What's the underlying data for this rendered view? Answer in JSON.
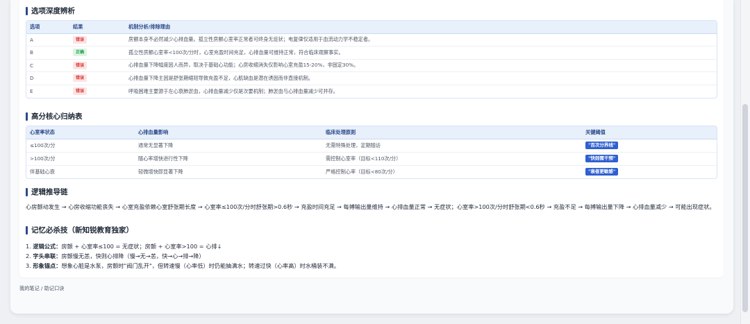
{
  "sections": {
    "analysis_title": "选项深度辨析",
    "summary_title": "高分核心归纳表",
    "logic_title": "逻辑推导链",
    "memory_title": "记忆必杀技（新知锐教育独家）"
  },
  "analysis_table": {
    "headers": [
      "选项",
      "结果",
      "机制分析/排除理由"
    ],
    "rows": [
      {
        "option": "A",
        "result": "错误",
        "result_type": "wrong",
        "reason": "房颤本身不必然减少心排血量。孤立性房颤心室率正常者可终身无症状；电复律仅适用于血流动力学不稳定者。"
      },
      {
        "option": "B",
        "result": "正确",
        "result_type": "right",
        "reason": "孤立性房颤心室率<100次/分时，心室充盈时间充足，心排血量可维持正常，符合临床观察事实。"
      },
      {
        "option": "C",
        "result": "错误",
        "result_type": "wrong",
        "reason": "心排血量下降幅度因人而异，取决于基础心功能；心房收缩消失仅影响心室充盈15-20%，非固定30%。"
      },
      {
        "option": "D",
        "result": "错误",
        "result_type": "wrong",
        "reason": "心排血量下降主因是舒张期缩短导致充盈不足，心肌缺血是潜在诱因而非直接机制。"
      },
      {
        "option": "E",
        "result": "错误",
        "result_type": "wrong",
        "reason": "呼吸困难主要源于左心衰肺淤血，心排血量减少仅是次要机制；肺淤血与心排血量减少可并存。"
      }
    ]
  },
  "summary_table": {
    "headers": [
      "心室率状态",
      "心排血量影响",
      "临床处理原则",
      "关键阈值"
    ],
    "rows": [
      {
        "state": "≤100次/分",
        "effect": "通常无显著下降",
        "principle": "无需特殊处理，定期随访",
        "threshold": "\"百次分界线\""
      },
      {
        "state": ">100次/分",
        "effect": "随心率增快进行性下降",
        "principle": "需控制心室率（目标<110次/分）",
        "threshold": "\"快则需干预\""
      },
      {
        "state": "伴基础心衰",
        "effect": "轻微增快即显著下降",
        "principle": "严格控制心率（目标<80次/分）",
        "threshold": "\"衰者更敏感\""
      }
    ],
    "threshold_color": "#2f5fd0"
  },
  "logic_chain": "心房颤动发生 → 心房收缩功能丧失 → 心室充盈依赖心室舒张期长度 → 心室率≤100次/分时舒张期>0.6秒 → 充盈时间充足 → 每搏输出量维持 → 心排血量正常 → 无症状；心室率>100次/分时舒张期<0.6秒 → 充盈不足 → 每搏输出量下降 → 心排血量减少 → 可能出现症状。",
  "memory_items": [
    {
      "num": "1.",
      "label": "逻辑公式：",
      "text": "房颤 + 心室率≤100 = 无症状；房颤 + 心室率>100 = 心排↓"
    },
    {
      "num": "2.",
      "label": "字头串联：",
      "text": "房颤慢无恙，快则心排降（慢→无→恙，快→心→排→降）"
    },
    {
      "num": "3.",
      "label": "形象锚点：",
      "text": "想象心脏是水泵，房颤时\"阀门乱开\"，但转速慢（心率低）时仍能抽满水；转速过快（心率高）时水桶装不满。"
    }
  ],
  "footer_note": "我的笔记 / 助记口诀",
  "colors": {
    "accent": "#2b4a8b",
    "wrong": "#d93636",
    "right": "#1f9a4b"
  }
}
